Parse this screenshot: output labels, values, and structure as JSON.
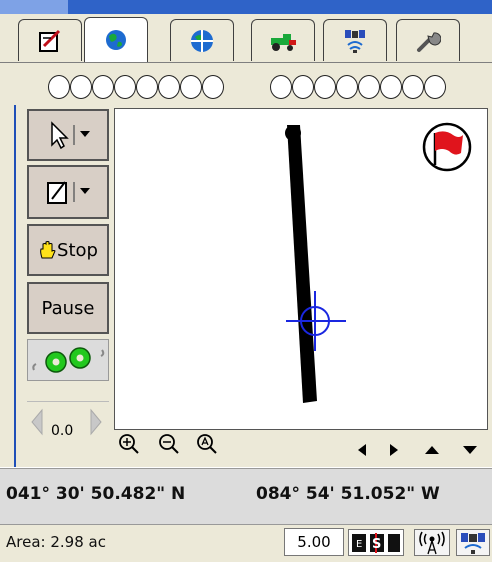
{
  "tabs": [
    {
      "icon": "field-record-icon",
      "active": false
    },
    {
      "icon": "globe-icon",
      "active": true
    },
    {
      "icon": "gps-globe-icon",
      "active": false
    },
    {
      "icon": "tractor-icon",
      "active": false
    },
    {
      "icon": "satellite-icon",
      "active": false
    },
    {
      "icon": "wrench-icon",
      "active": false
    }
  ],
  "toolbar": {
    "stop_label": "Stop",
    "pause_label": "Pause",
    "speed_value": "0.0"
  },
  "coordinates": {
    "latitude": "041° 30' 50.482\" N",
    "longitude": "084° 54' 51.052\" W"
  },
  "status": {
    "area": "Area: 2.98 ac",
    "width_value": "5.00"
  },
  "colors": {
    "accent_blue": "#2f63c8",
    "panel_bg": "#ece9d8",
    "button_bg": "#d8cfc6",
    "flag_red": "#e0141c",
    "gear_green": "#22c81e",
    "crosshair_blue": "#1a27e0"
  },
  "icons": {
    "pointer_tool": "pointer-icon",
    "record_tool": "record-icon",
    "stop_icon": "hand-icon",
    "gear_icon": "gears-icon",
    "flag_icon": "flag-icon",
    "crosshair": "crosshair-icon"
  }
}
